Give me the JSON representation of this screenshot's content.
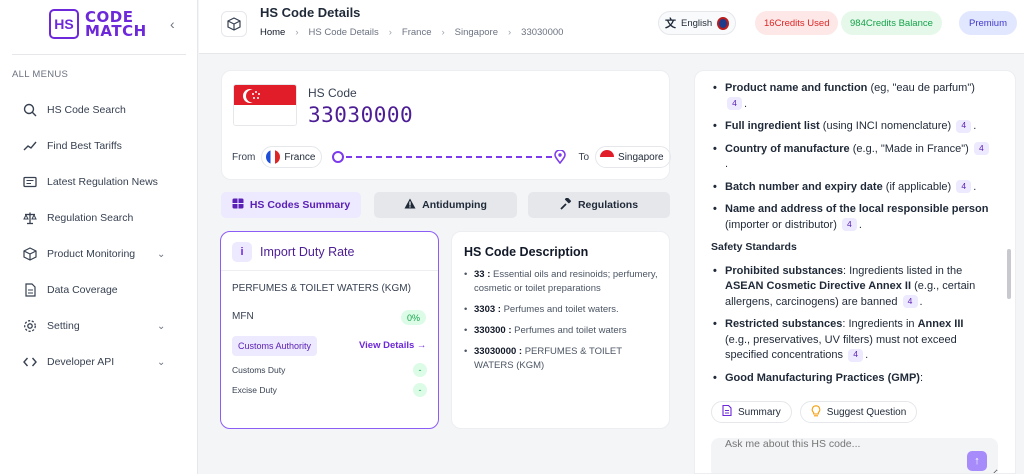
{
  "brand": {
    "logo_mark": "HS",
    "line1": "CODE",
    "line2": "MATCH"
  },
  "sidebar": {
    "heading": "ALL MENUS",
    "items": [
      {
        "label": "HS Code Search",
        "icon": "search-icon"
      },
      {
        "label": "Find Best Tariffs",
        "icon": "trend-icon"
      },
      {
        "label": "Latest Regulation News",
        "icon": "news-icon"
      },
      {
        "label": "Regulation Search",
        "icon": "scale-icon"
      },
      {
        "label": "Product Monitoring",
        "icon": "box-icon",
        "expandable": true
      },
      {
        "label": "Data Coverage",
        "icon": "document-icon"
      },
      {
        "label": "Setting",
        "icon": "gear-icon",
        "expandable": true
      },
      {
        "label": "Developer API",
        "icon": "code-icon",
        "expandable": true
      }
    ]
  },
  "header": {
    "title": "HS Code Details",
    "breadcrumb": [
      "Home",
      "HS Code Details",
      "France",
      "Singapore",
      "33030000"
    ],
    "language": "English",
    "credits_used": "16Credits Used",
    "credits_balance": "984Credits Balance",
    "plan": "Premium"
  },
  "hs_card": {
    "label": "HS Code",
    "code": "33030000",
    "from_label": "From",
    "from_country": "France",
    "to_label": "To",
    "to_country": "Singapore"
  },
  "tabs": [
    "HS Codes Summary",
    "Antidumping",
    "Regulations"
  ],
  "duty": {
    "title": "Import Duty Rate",
    "product": "PERFUMES & TOILET WATERS (KGM)",
    "mfn_label": "MFN",
    "mfn_value": "0%",
    "authority_label": "Customs Authority",
    "view_details": "View Details →",
    "rows": [
      {
        "label": "Customs Duty",
        "value": "-"
      },
      {
        "label": "Excise Duty",
        "value": "-"
      }
    ]
  },
  "description": {
    "title": "HS Code Description",
    "items": [
      {
        "code": "33 :",
        "text": " Essential oils and resinoids; perfumery, cosmetic or toilet preparations"
      },
      {
        "code": "3303 :",
        "text": " Perfumes and toilet waters."
      },
      {
        "code": "330300 :",
        "text": " Perfumes and toilet waters"
      },
      {
        "code": "33030000 :",
        "text": " PERFUMES & TOILET WATERS (KGM)"
      }
    ]
  },
  "chat": {
    "bullets_a": [
      {
        "bold": "Product name and function",
        "text": " (eg, \"eau de parfum\")",
        "ref": "4"
      },
      {
        "bold": "Full ingredient list",
        "text": " (using INCI nomenclature)",
        "ref": "4"
      },
      {
        "bold": "Country of manufacture",
        "text": " (e.g., \"Made in France\")",
        "ref": "4"
      },
      {
        "bold": "Batch number and expiry date",
        "text": " (if applicable)",
        "ref": "4"
      },
      {
        "bold": "Name and address of the local responsible person",
        "text": " (importer or distributor)",
        "ref": "4"
      }
    ],
    "section": "Safety Standards",
    "b1_bold": "Prohibited substances",
    "b1_text1": ": Ingredients listed in the ",
    "b1_bold2": "ASEAN Cosmetic Directive Annex II",
    "b1_text2": " (e.g., certain allergens, carcinogens) are banned",
    "b1_ref": "4",
    "b2_bold": "Restricted substances",
    "b2_text1": ": Ingredients in ",
    "b2_bold2": "Annex III",
    "b2_text2": " (e.g., preservatives, UV filters) must not exceed specified concentrations",
    "b2_ref": "4",
    "b3_bold": "Good Manufacturing Practices (GMP)",
    "b3_text": ":",
    "chip_summary": "Summary",
    "chip_suggest": "Suggest Question",
    "input_placeholder": "Ask me about this HS code..."
  },
  "colors": {
    "accent": "#6d28d9",
    "credits_used": "#dc2626",
    "credits_balance": "#16a34a",
    "premium": "#4338ca"
  }
}
